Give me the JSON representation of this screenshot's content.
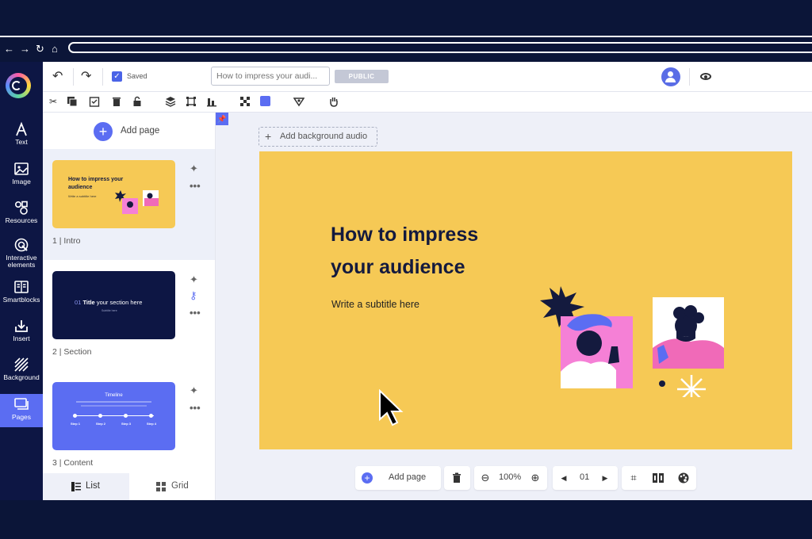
{
  "app": {
    "saved_label": "Saved",
    "title_placeholder": "How to impress your audi...",
    "visibility_badge": "PUBLIC"
  },
  "rail": {
    "items": [
      {
        "label": "Text",
        "icon": "text-icon"
      },
      {
        "label": "Image",
        "icon": "image-icon"
      },
      {
        "label": "Resources",
        "icon": "resources-icon"
      },
      {
        "label": "Interactive elements",
        "icon": "interactive-icon"
      },
      {
        "label": "Smartblocks",
        "icon": "smartblocks-icon"
      },
      {
        "label": "Insert",
        "icon": "insert-icon"
      },
      {
        "label": "Background",
        "icon": "background-icon"
      },
      {
        "label": "Pages",
        "icon": "pages-icon"
      }
    ]
  },
  "panel": {
    "add_page_label": "Add page",
    "slides": [
      {
        "caption": "1 | Intro",
        "title": "How to impress your audience",
        "subtitle": "Write a subtitle here"
      },
      {
        "caption": "2 | Section",
        "number": "01",
        "title": "Title",
        "title_rest": "your section here",
        "subtitle": "Subtitle here"
      },
      {
        "caption": "3 | Content",
        "title": "Timeline",
        "steps": [
          "Step 1",
          "Step 2",
          "Step 3",
          "Step 4"
        ]
      }
    ],
    "tabs": {
      "list": "List",
      "grid": "Grid"
    }
  },
  "canvas": {
    "bg_audio_label": "Add background audio",
    "slide_title": "How to impress your audience",
    "slide_title_line1": "How to impress",
    "slide_title_line2": "your audience",
    "slide_subtitle": "Write a subtitle here",
    "slide_color": "#f6c955"
  },
  "bottom": {
    "add_page_label": "Add page",
    "zoom": "100%",
    "page_number": "01"
  },
  "colors": {
    "accent": "#5b6df2",
    "rail_bg": "#0d1644",
    "page_bg": "#0b1538"
  }
}
